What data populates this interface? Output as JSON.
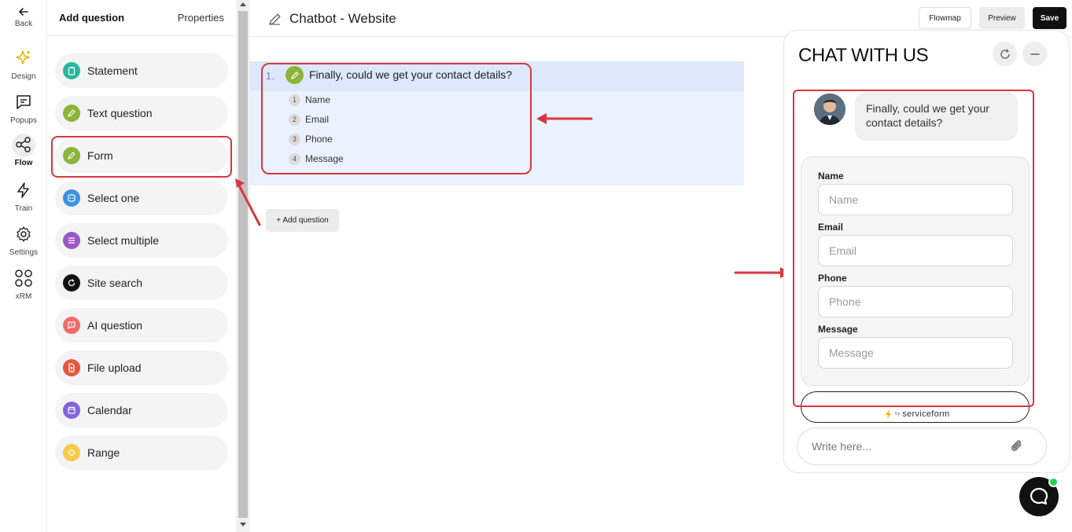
{
  "rail": {
    "back": "Back",
    "items": [
      {
        "label": "Design",
        "icon": "sparkles-icon"
      },
      {
        "label": "Popups",
        "icon": "message-square-icon"
      },
      {
        "label": "Flow",
        "icon": "share-nodes-icon"
      },
      {
        "label": "Train",
        "icon": "lightning-icon"
      },
      {
        "label": "Settings",
        "icon": "gear-icon"
      },
      {
        "label": "xRM",
        "icon": "grid-icon"
      }
    ],
    "active": "Flow"
  },
  "panel": {
    "title": "Add question",
    "properties": "Properties",
    "types": [
      {
        "label": "Statement",
        "color": "#27b8a0"
      },
      {
        "label": "Text question",
        "color": "#8cb53a"
      },
      {
        "label": "Form",
        "color": "#8cb53a"
      },
      {
        "label": "Select one",
        "color": "#3d94e0"
      },
      {
        "label": "Select multiple",
        "color": "#9b59c4"
      },
      {
        "label": "Site search",
        "color": "#111111"
      },
      {
        "label": "AI question",
        "color": "#f06a6a"
      },
      {
        "label": "File upload",
        "color": "#e8543e"
      },
      {
        "label": "Calendar",
        "color": "#8263e0"
      },
      {
        "label": "Range",
        "color": "#f7c948"
      }
    ]
  },
  "header": {
    "title": "Chatbot - Website",
    "flowmap": "Flowmap",
    "preview": "Preview",
    "save": "Save"
  },
  "flow": {
    "question": {
      "number": "1.",
      "text": "Finally, could we get your contact details?",
      "fields": [
        {
          "n": "1",
          "label": "Name"
        },
        {
          "n": "2",
          "label": "Email"
        },
        {
          "n": "3",
          "label": "Phone"
        },
        {
          "n": "4",
          "label": "Message"
        }
      ]
    },
    "add_question": "+ Add question"
  },
  "chat": {
    "title": "CHAT WITH US",
    "bubble": "Finally, could we get your contact details?",
    "form": {
      "name_label": "Name",
      "name_placeholder": "Name",
      "email_label": "Email",
      "email_placeholder": "Email",
      "phone_label": "Phone",
      "phone_placeholder": "Phone",
      "message_label": "Message",
      "message_placeholder": "Message"
    },
    "powered_by": "by",
    "brand": "serviceform",
    "input_placeholder": "Write here..."
  },
  "colors": {
    "highlight": "#d9363e",
    "accent_green": "#8cb53a",
    "status_online": "#22d05a"
  }
}
